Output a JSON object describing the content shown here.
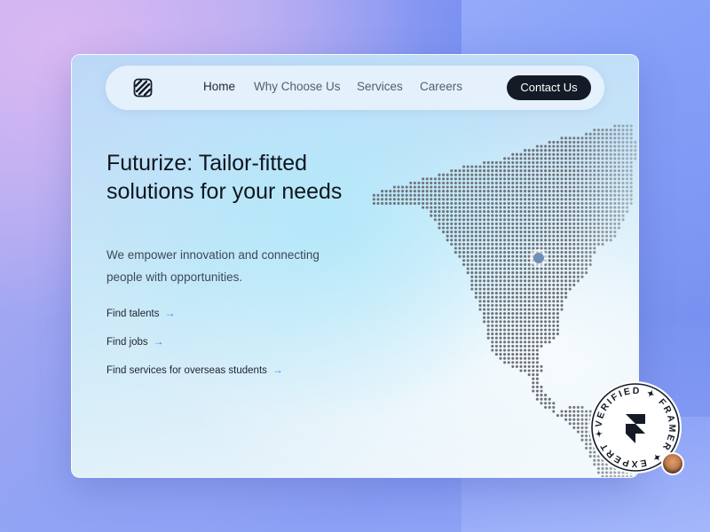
{
  "nav": {
    "logo_icon": "brand-logo-icon",
    "links": [
      "Home",
      "Why Choose Us",
      "Services",
      "Careers"
    ],
    "active_link": "Home",
    "contact_label": "Contact Us"
  },
  "hero": {
    "title": "Futurize: Tailor-fitted solutions for your needs",
    "subtitle": "We empower innovation and connecting people with opportunities.",
    "links": [
      "Find talents",
      "Find jobs",
      "Find services for overseas students"
    ],
    "arrow_glyph": "→"
  },
  "map": {
    "icon": "americas-dotted-map",
    "dot_color": "#6f7379",
    "marker_color": "#6f8fb8"
  },
  "badge": {
    "text": "VERIFIED ✦ FRAMER ✦ EXPERT ✦",
    "icon": "framer-logo-icon"
  },
  "colors": {
    "accent": "#3a86ff",
    "button_bg": "#141b26",
    "text_dark": "#10161f"
  }
}
